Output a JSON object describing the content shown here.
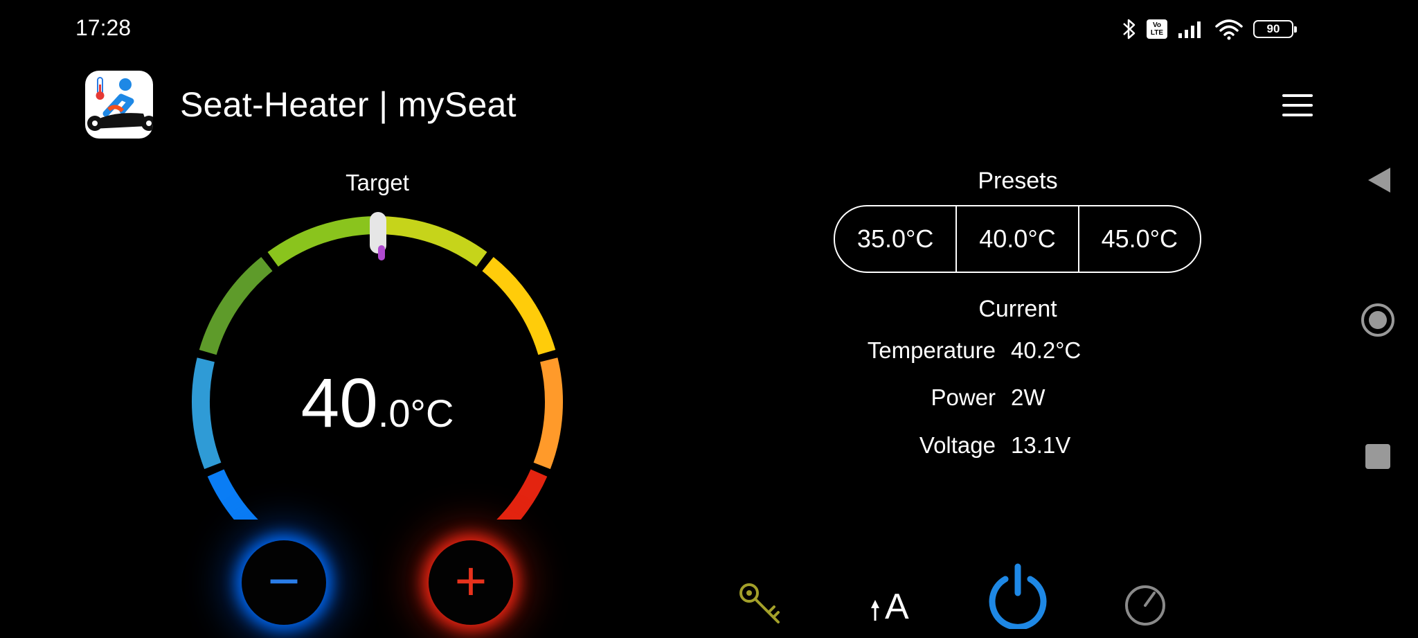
{
  "status_bar": {
    "time": "17:28",
    "battery": "90",
    "volte_top": "Vo",
    "volte_bottom": "LTE"
  },
  "app_bar": {
    "title": "Seat-Heater | mySeat"
  },
  "target": {
    "label": "Target",
    "value_int": "40",
    "value_dec": ".0",
    "unit": "°C",
    "slider_fraction": 0.5
  },
  "controls": {
    "minus": "−",
    "plus": "+"
  },
  "presets": {
    "label": "Presets",
    "options": [
      "35.0°C",
      "40.0°C",
      "45.0°C"
    ]
  },
  "current": {
    "label": "Current",
    "temperature_label": "Temperature",
    "temperature_value": "40.2°C",
    "power_label": "Power",
    "power_value": "2W",
    "voltage_label": "Voltage",
    "voltage_value": "13.1V"
  },
  "toolbar": {
    "auto_letter": "A"
  },
  "colors": {
    "accent_blue": "#1e88e5",
    "key_olive": "#a3a02a",
    "timer_gray": "#8a8a8a",
    "gauge_segments": [
      "#0a7df5",
      "#2f9bd6",
      "#5e9b2a",
      "#8ac41d",
      "#c6d41a",
      "#ffcc0a",
      "#ff9a2a",
      "#e32410"
    ]
  }
}
